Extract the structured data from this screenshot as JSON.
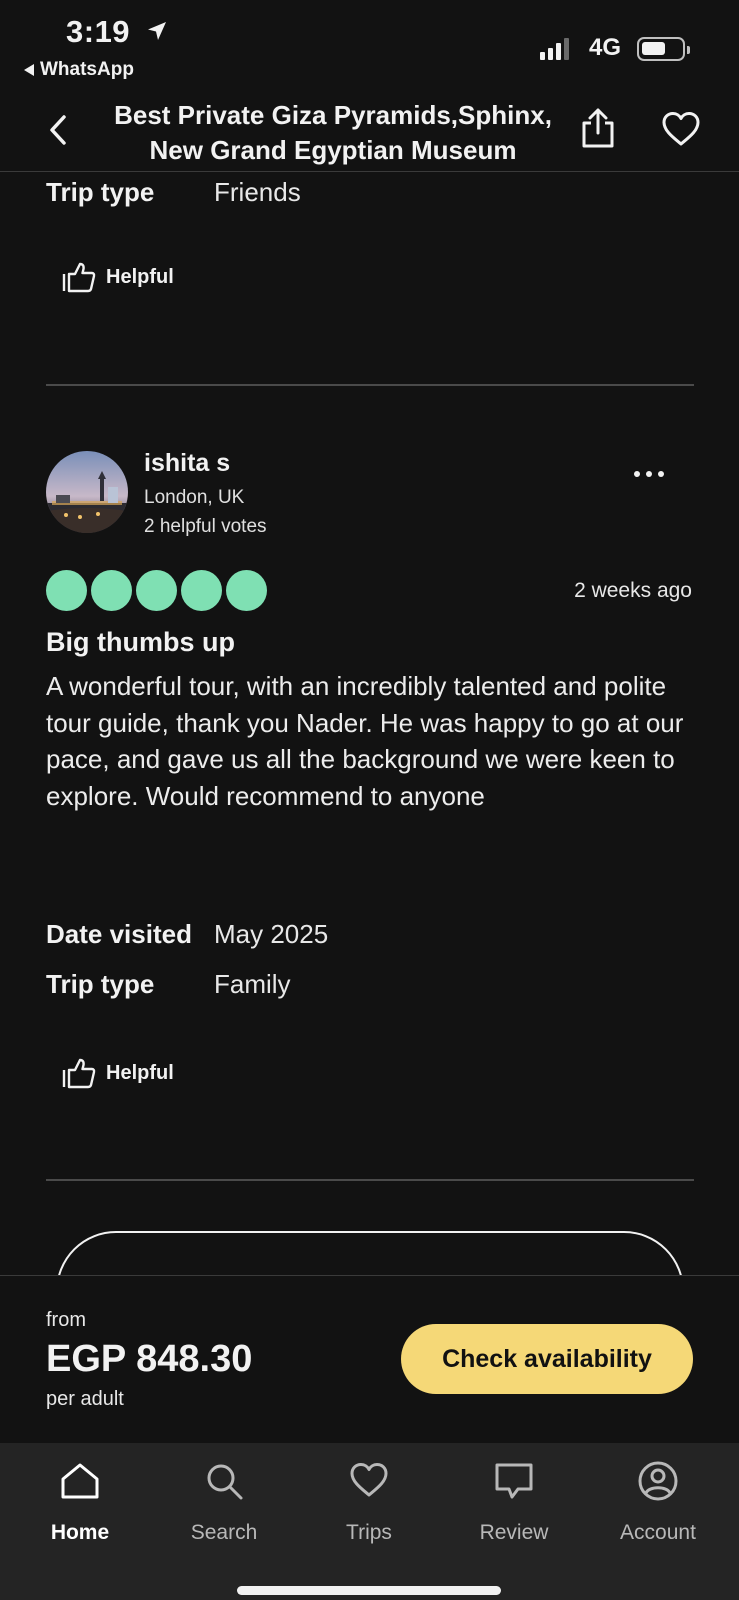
{
  "status_bar": {
    "time": "3:19",
    "back_app": "WhatsApp",
    "network": "4G",
    "battery_level": 0.6
  },
  "header": {
    "title": "Best Private Giza Pyramids,Sphinx, New Grand Egyptian Museum",
    "icons": [
      "chevron-left-icon",
      "share-icon",
      "heart-icon"
    ]
  },
  "previous_review": {
    "trip_type_label": "Trip type",
    "trip_type_value": "Friends",
    "helpful_label": "Helpful"
  },
  "review": {
    "user_name": "ishita s",
    "user_location": "London, UK",
    "user_votes": "2 helpful votes",
    "rating": 5,
    "rating_max": 5,
    "rating_color": "#7fe0b3",
    "time_ago": "2 weeks ago",
    "title": "Big thumbs up",
    "body": "A wonderful tour, with an incredibly talented and polite tour guide, thank you Nader. He was happy to go at our pace, and gave us all the background we were keen to explore. Would recommend to anyone",
    "date_visited_label": "Date visited",
    "date_visited_value": "May 2025",
    "trip_type_label": "Trip type",
    "trip_type_value": "Family",
    "helpful_label": "Helpful"
  },
  "price_bar": {
    "from_label": "from",
    "price": "EGP 848.30",
    "per_label": "per adult",
    "cta_label": "Check availability",
    "cta_color": "#f5d877"
  },
  "nav": {
    "items": [
      {
        "label": "Home",
        "icon": "home-icon",
        "active": true
      },
      {
        "label": "Search",
        "icon": "search-icon",
        "active": false
      },
      {
        "label": "Trips",
        "icon": "heart-icon",
        "active": false
      },
      {
        "label": "Review",
        "icon": "speech-bubble-icon",
        "active": false
      },
      {
        "label": "Account",
        "icon": "user-circle-icon",
        "active": false
      }
    ]
  }
}
